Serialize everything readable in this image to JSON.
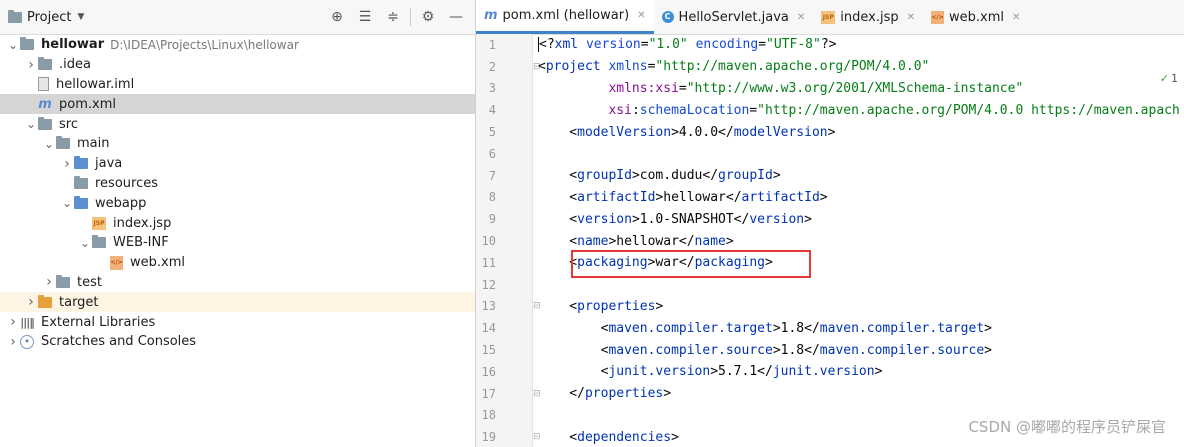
{
  "project_panel": {
    "title": "Project",
    "tools": [
      "crosshair-icon",
      "expand-all-icon",
      "collapse-all-icon",
      "gear-icon",
      "minimize-icon"
    ],
    "tree": [
      {
        "indent": 0,
        "arrow": "down",
        "icon": "folder",
        "label": "hellowar",
        "path": "D:\\IDEA\\Projects\\Linux\\hellowar",
        "bold": true
      },
      {
        "indent": 1,
        "arrow": "right",
        "icon": "folder",
        "label": ".idea"
      },
      {
        "indent": 1,
        "arrow": "",
        "icon": "iml",
        "label": "hellowar.iml"
      },
      {
        "indent": 1,
        "arrow": "",
        "icon": "m",
        "label": "pom.xml",
        "selected": true
      },
      {
        "indent": 1,
        "arrow": "down",
        "icon": "folder",
        "label": "src"
      },
      {
        "indent": 2,
        "arrow": "down",
        "icon": "folder",
        "label": "main"
      },
      {
        "indent": 3,
        "arrow": "right",
        "icon": "folder-blue",
        "label": "java"
      },
      {
        "indent": 3,
        "arrow": "",
        "icon": "folder",
        "label": "resources"
      },
      {
        "indent": 3,
        "arrow": "down",
        "icon": "folder-blue",
        "label": "webapp"
      },
      {
        "indent": 4,
        "arrow": "",
        "icon": "jsp",
        "label": "index.jsp"
      },
      {
        "indent": 4,
        "arrow": "down",
        "icon": "folder",
        "label": "WEB-INF"
      },
      {
        "indent": 5,
        "arrow": "",
        "icon": "xml",
        "label": "web.xml"
      },
      {
        "indent": 2,
        "arrow": "right",
        "icon": "folder",
        "label": "test"
      },
      {
        "indent": 1,
        "arrow": "right",
        "icon": "folder-orange",
        "label": "target",
        "highlight": true
      },
      {
        "indent": 0,
        "arrow": "right",
        "icon": "lib",
        "label": "External Libraries"
      },
      {
        "indent": 0,
        "arrow": "right",
        "icon": "scratch",
        "label": "Scratches and Consoles"
      }
    ]
  },
  "tabs": [
    {
      "icon": "m",
      "label": "pom.xml (hellowar)",
      "active": true
    },
    {
      "icon": "c",
      "label": "HelloServlet.java"
    },
    {
      "icon": "jsp",
      "label": "index.jsp"
    },
    {
      "icon": "xml",
      "label": "web.xml"
    }
  ],
  "editor": {
    "inspection": "1",
    "lines": [
      {
        "n": "1",
        "html": "<span class=\"caret-cursor\"></span>&lt;?<span class=\"tag\">xml</span> <span class=\"attr\">version</span>=<span class=\"val\">\"1.0\"</span> <span class=\"attr\">encoding</span>=<span class=\"val\">\"UTF-8\"</span>?&gt;"
      },
      {
        "n": "2",
        "html": "&lt;<span class=\"tag\">project</span> <span class=\"attr\">xmlns</span>=<span class=\"val\">\"http://maven.apache.org/POM/4.0.0\"</span>",
        "fold": true
      },
      {
        "n": "3",
        "html": "         <span class=\"ns\">xmlns:xsi</span>=<span class=\"val\">\"http://www.w3.org/2001/XMLSchema-instance\"</span>"
      },
      {
        "n": "4",
        "html": "         <span class=\"ns\">xsi</span>:<span class=\"attr\">schemaLocation</span>=<span class=\"val\">\"http://maven.apache.org/POM/4.0.0 https://maven.apach</span>"
      },
      {
        "n": "5",
        "html": "    &lt;<span class=\"tag\">modelVersion</span>&gt;4.0.0&lt;/<span class=\"tag\">modelVersion</span>&gt;"
      },
      {
        "n": "6",
        "html": ""
      },
      {
        "n": "7",
        "html": "    &lt;<span class=\"tag\">groupId</span>&gt;com.dudu&lt;/<span class=\"tag\">groupId</span>&gt;"
      },
      {
        "n": "8",
        "html": "    &lt;<span class=\"tag\">artifactId</span>&gt;hellowar&lt;/<span class=\"tag\">artifactId</span>&gt;"
      },
      {
        "n": "9",
        "html": "    &lt;<span class=\"tag\">version</span>&gt;1.0-SNAPSHOT&lt;/<span class=\"tag\">version</span>&gt;"
      },
      {
        "n": "10",
        "html": "    &lt;<span class=\"tag\">name</span>&gt;hellowar&lt;/<span class=\"tag\">name</span>&gt;"
      },
      {
        "n": "11",
        "html": "    &lt;<span class=\"tag\">packaging</span>&gt;war&lt;/<span class=\"tag\">packaging</span>&gt;"
      },
      {
        "n": "12",
        "html": ""
      },
      {
        "n": "13",
        "html": "    &lt;<span class=\"tag\">properties</span>&gt;",
        "fold": true
      },
      {
        "n": "14",
        "html": "        &lt;<span class=\"tag\">maven.compiler.target</span>&gt;1.8&lt;/<span class=\"tag\">maven.compiler.target</span>&gt;"
      },
      {
        "n": "15",
        "html": "        &lt;<span class=\"tag\">maven.compiler.source</span>&gt;1.8&lt;/<span class=\"tag\">maven.compiler.source</span>&gt;"
      },
      {
        "n": "16",
        "html": "        &lt;<span class=\"tag\">junit.version</span>&gt;5.7.1&lt;/<span class=\"tag\">junit.version</span>&gt;"
      },
      {
        "n": "17",
        "html": "    &lt;/<span class=\"tag\">properties</span>&gt;",
        "fold": true
      },
      {
        "n": "18",
        "html": ""
      },
      {
        "n": "19",
        "html": "    &lt;<span class=\"tag\">dependencies</span>&gt;",
        "fold": true
      }
    ]
  },
  "watermark": "CSDN @嘟嘟的程序员铲屎官"
}
